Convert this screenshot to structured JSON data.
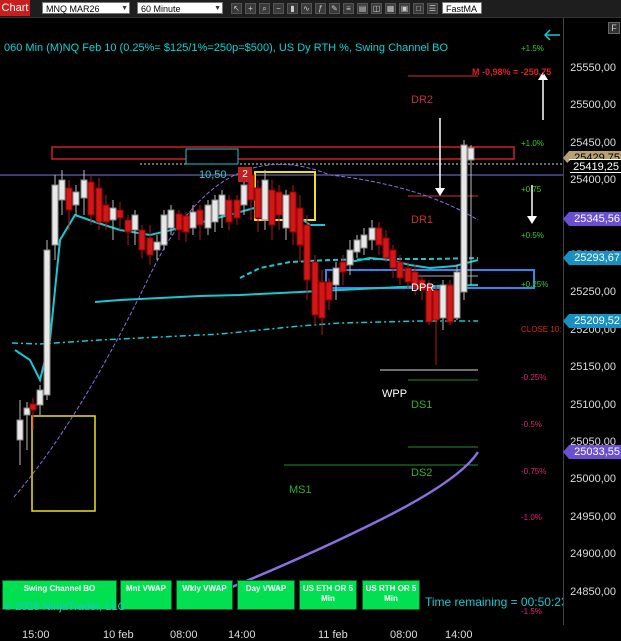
{
  "toolbar": {
    "chart_tab": "Chart",
    "instrument": "MNQ MAR26",
    "timeframe": "60 Minute",
    "indicator": "FastMA"
  },
  "chart": {
    "title": "060 Min (M)NQ Feb 10 (0.25%= $125/1%=250p=$500), US Dy RTH %, Swing Channel BO",
    "annotation_top": "M -0,98% = -250,75",
    "box_value": "10,50",
    "box_count": "2",
    "levels": {
      "dr2": "DR2",
      "dr1": "DR1",
      "dpr": "DPR",
      "wpp": "WPP",
      "ds1": "DS1",
      "ds2": "DS2",
      "ms1": "MS1",
      "close": "CLOSE 10:"
    },
    "percents": {
      "p15": "+1.5%",
      "p10": "+1.0%",
      "p075": "+0.75",
      "p05": "+0.5%",
      "p025": "+0.25%",
      "m025": "-0.25%",
      "m05": "-0.5%",
      "m075": "-0.75%",
      "m10": "-1.0%",
      "m15": "-1.5%"
    },
    "copyright": "© 2026 NinjaTrader, LLC",
    "time_remaining": "Time remaining = 00:50:23"
  },
  "buttons": [
    {
      "label": "Swing Channel BO"
    },
    {
      "label": "Mnt VWAP"
    },
    {
      "label": "Wkly VWAP"
    },
    {
      "label": "Day VWAP"
    },
    {
      "label": "US ETH OR 5 Min"
    },
    {
      "label": "US RTH OR 5 Min"
    }
  ],
  "price_axis": {
    "labels": [
      "25550,00",
      "25500,00",
      "25450,00",
      "25400,00",
      "25350,00",
      "25300,00",
      "25250,00",
      "25200,00",
      "25150,00",
      "25100,00",
      "25050,00",
      "25000,00",
      "24950,00",
      "24900,00",
      "24850,00"
    ],
    "badges": {
      "b1": "25429,75",
      "b2": "25419,25",
      "b3": "25345,56",
      "b4": "25293,67",
      "b5": "25209,52",
      "b6": "25033,55"
    }
  },
  "time_axis": [
    "15:00",
    "10 feb",
    "08:00",
    "14:00",
    "11 feb",
    "08:00",
    "14:00"
  ],
  "colors": {
    "up": "#e8e8e8",
    "down": "#d01818",
    "cyan": "#18c8d0",
    "purple": "#8a6fe0",
    "badge_purple": "#6a4fd0"
  }
}
